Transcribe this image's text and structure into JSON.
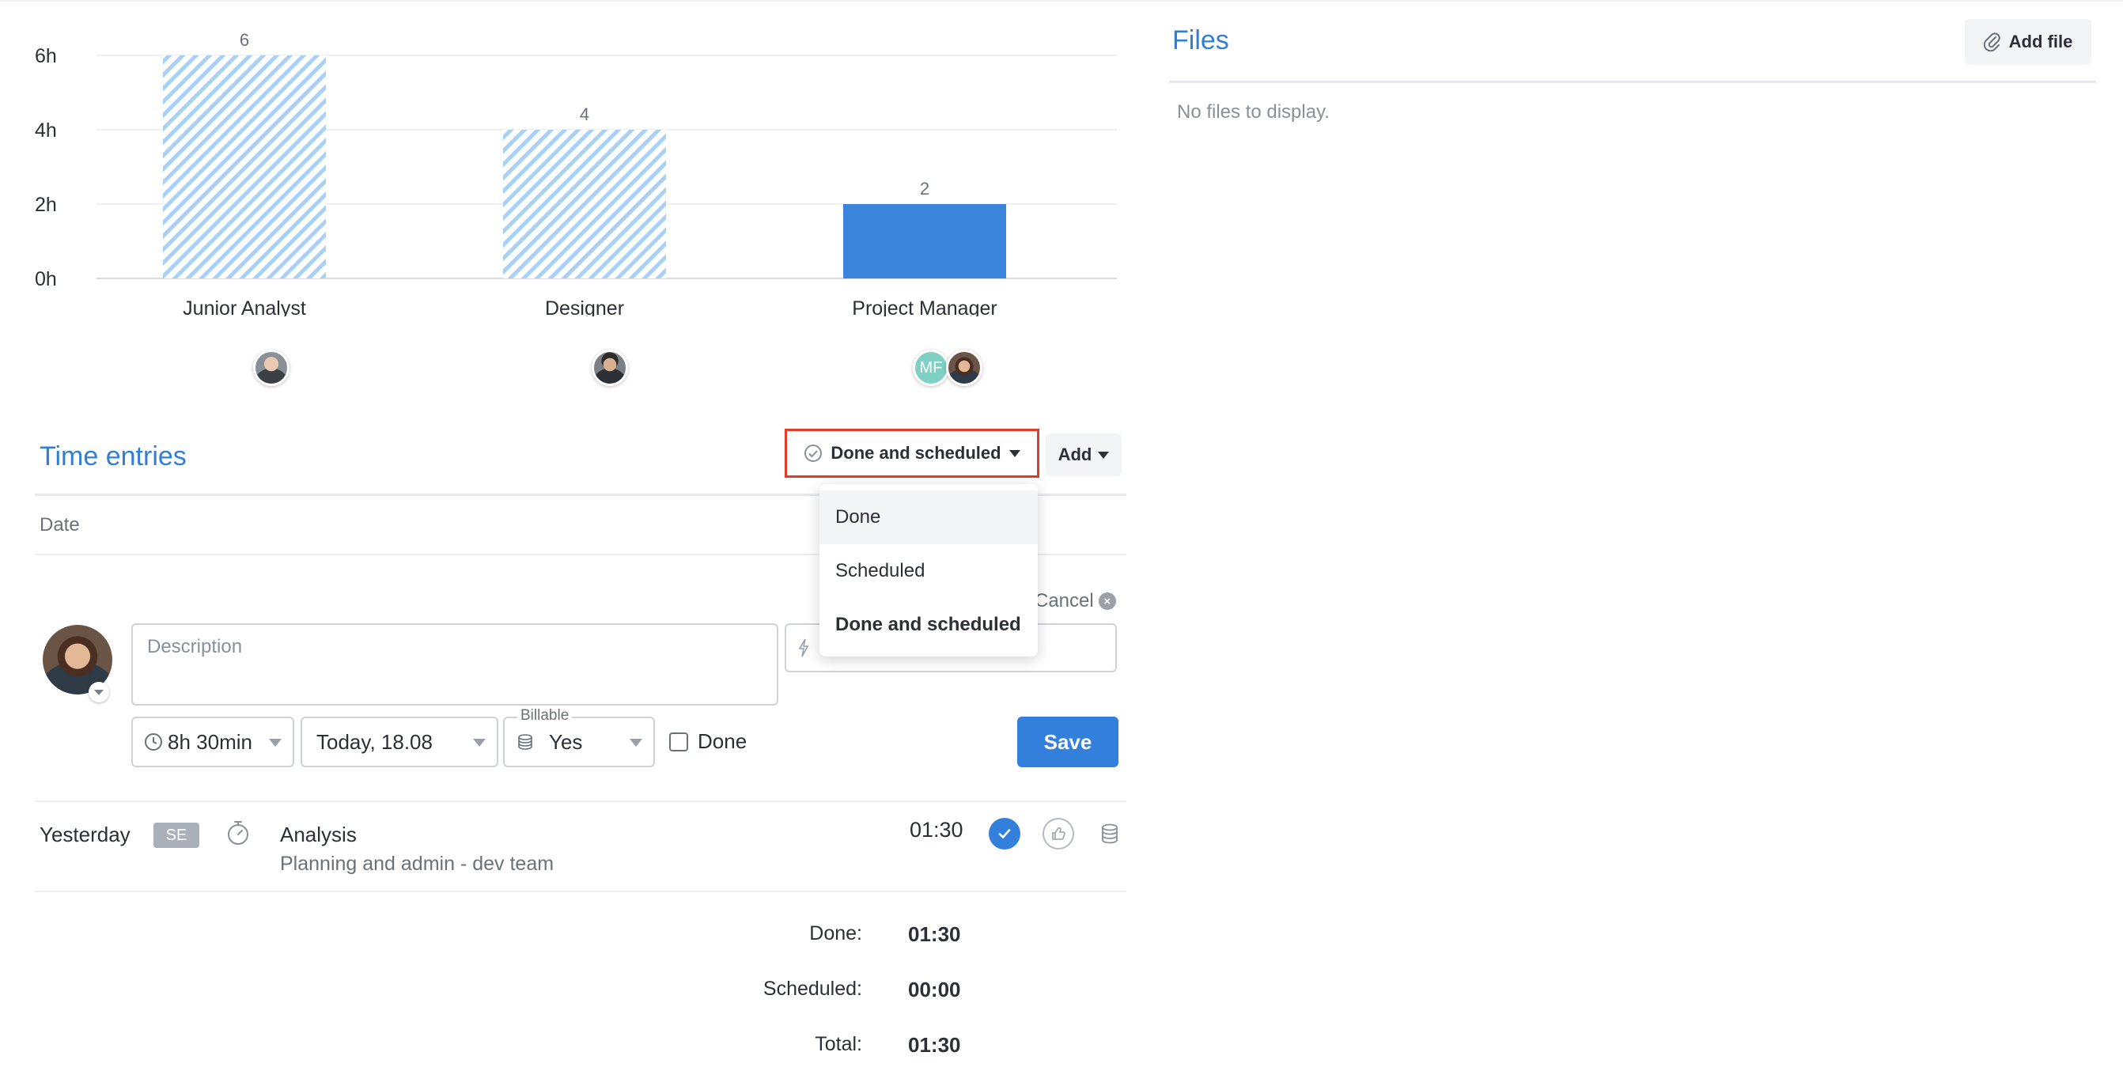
{
  "chart_data": {
    "type": "bar",
    "categories": [
      "Junior Analyst",
      "Designer",
      "Project Manager"
    ],
    "values": [
      6,
      4,
      2
    ],
    "value_labels": [
      "6",
      "4",
      "2"
    ],
    "styles": [
      "hatched",
      "hatched",
      "solid"
    ],
    "y_ticks": [
      "0h",
      "2h",
      "4h",
      "6h"
    ],
    "ylim": [
      0,
      6
    ],
    "grid": true,
    "colors": {
      "hatched": "#a9d0f5",
      "solid": "#3a84dc"
    }
  },
  "chart_avatars": {
    "pm_initials": "MF"
  },
  "files": {
    "title": "Files",
    "add_label": "Add file",
    "empty_text": "No files to display."
  },
  "time_entries": {
    "title": "Time entries",
    "filter_label": "Done and scheduled",
    "add_label": "Add",
    "date_header": "Date",
    "filter_options": [
      "Done",
      "Scheduled",
      "Done and scheduled"
    ]
  },
  "form": {
    "cancel_label": "Cancel",
    "description_placeholder": "Description",
    "duration": "8h 30min",
    "date": "Today, 18.08",
    "billable_label": "Billable",
    "billable_value": "Yes",
    "done_label": "Done",
    "save_label": "Save"
  },
  "entry": {
    "day": "Yesterday",
    "badge": "SE",
    "title": "Analysis",
    "subtitle": "Planning and admin - dev team",
    "time": "01:30"
  },
  "totals": {
    "done_label": "Done:",
    "done_value": "01:30",
    "scheduled_label": "Scheduled:",
    "scheduled_value": "00:00",
    "total_label": "Total:",
    "total_value": "01:30"
  },
  "colors": {
    "accent": "#2f7fd6",
    "primary_button": "#3280dc",
    "highlight_border": "#e03d28"
  }
}
